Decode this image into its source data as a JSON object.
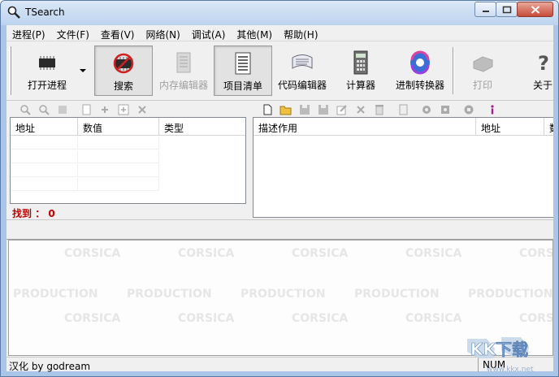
{
  "window": {
    "title": "TSearch"
  },
  "menu": [
    "进程(P)",
    "文件(F)",
    "查看(V)",
    "网络(N)",
    "调试(A)",
    "其他(M)",
    "帮助(H)"
  ],
  "toolbar": {
    "open_process": "打开进程",
    "search": "搜索",
    "memory_editor": "内存编辑器",
    "item_list": "项目清单",
    "code_editor": "代码编辑器",
    "calculator": "计算器",
    "base_converter": "进制转换器",
    "print": "打印",
    "about": "关于"
  },
  "search_table": {
    "columns": [
      "地址",
      "数值",
      "类型"
    ],
    "found_label": "找到 ： 0"
  },
  "item_table": {
    "columns": [
      "描述作用",
      "地址",
      "数"
    ]
  },
  "watermark": {
    "row1": [
      "CORSICA",
      "CORSICA",
      "CORSICA",
      "CORSICA",
      "CORSICA"
    ],
    "row2": [
      "PRODUCTION",
      "PRODUCTION",
      "PRODUCTION",
      "PRODUCTION",
      "PRODUCTION"
    ],
    "row3": [
      "CORSICA",
      "CORSICA",
      "CORSICA",
      "CORSICA",
      "CORSICA"
    ]
  },
  "status": {
    "text": "汉化 by godream",
    "num": "NUM"
  },
  "corner_logo": {
    "text": "KK下载",
    "url": "www.kkx.net"
  },
  "colors": {
    "found_red": "#c00000",
    "titlebar": "#bcd3ee",
    "close_button": "#c74a38"
  }
}
